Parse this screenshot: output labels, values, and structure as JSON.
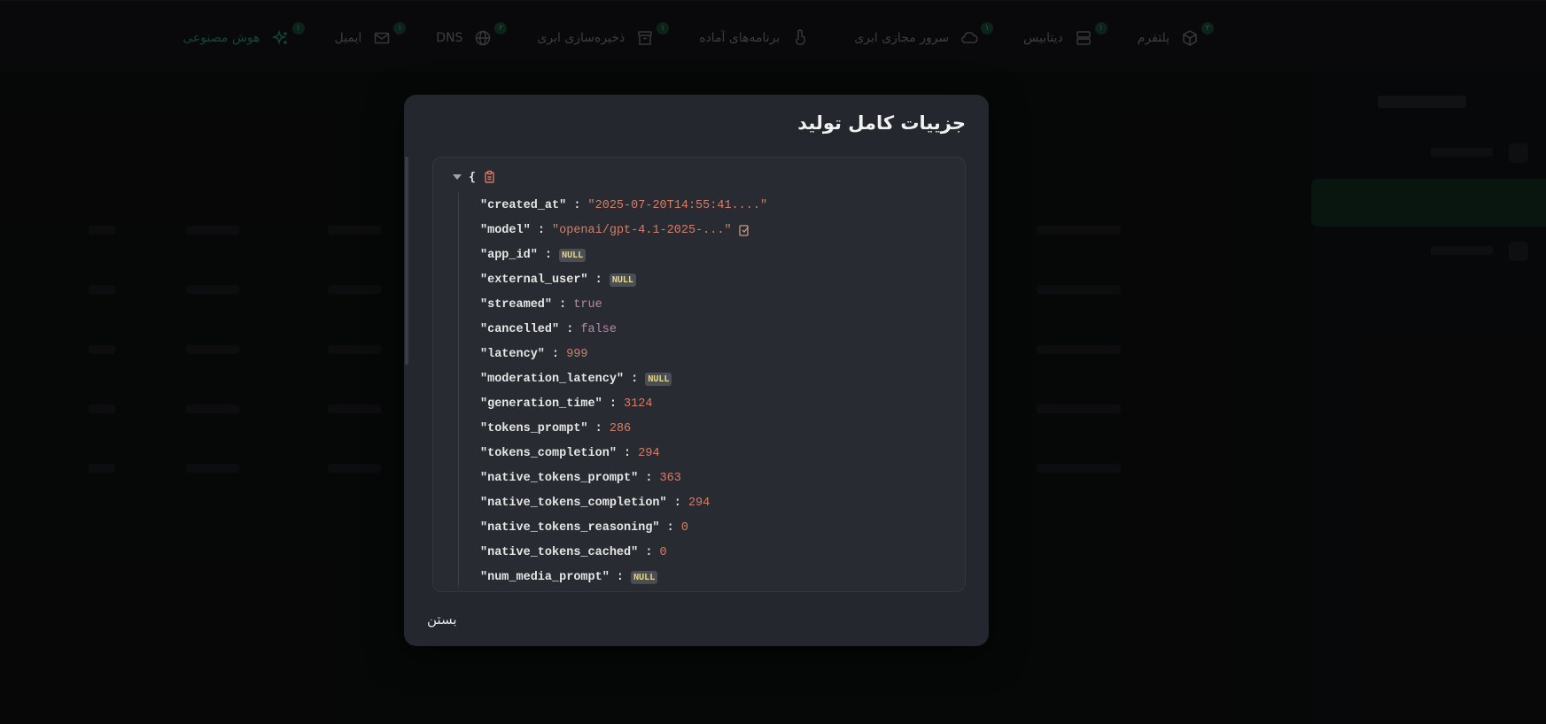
{
  "nav": {
    "items": [
      {
        "label": "پلتفرم",
        "badge": "۲",
        "icon": "cube-icon"
      },
      {
        "label": "دیتابیس",
        "badge": "۱",
        "icon": "database-icon"
      },
      {
        "label": "سرور مجازی ابری",
        "badge": "۱",
        "icon": "cloud-icon"
      },
      {
        "label": "برنامه‌های آماده",
        "badge": "",
        "icon": "app-icon"
      },
      {
        "label": "ذخیره‌سازی ابری",
        "badge": "۱",
        "icon": "archive-icon"
      },
      {
        "label": "DNS",
        "badge": "۲",
        "icon": "globe-icon"
      },
      {
        "label": "ایمیل",
        "badge": "۱",
        "icon": "mail-icon"
      },
      {
        "label": "هوش مصنوعی",
        "badge": "۱",
        "icon": "sparkle-icon",
        "active": true
      }
    ]
  },
  "modal": {
    "title": "جزییات کامل تولید",
    "close_label": "بستن",
    "json_open_brace": "{",
    "fields": [
      {
        "key": "\"created_at\"",
        "type": "string",
        "value": "\"2025-07-20T14:55:41....\""
      },
      {
        "key": "\"model\"",
        "type": "string",
        "value": "\"openai/gpt-4.1-2025-...\"",
        "copy": true
      },
      {
        "key": "\"app_id\"",
        "type": "null",
        "value": "NULL"
      },
      {
        "key": "\"external_user\"",
        "type": "null",
        "value": "NULL"
      },
      {
        "key": "\"streamed\"",
        "type": "bool",
        "value": "true"
      },
      {
        "key": "\"cancelled\"",
        "type": "bool",
        "value": "false"
      },
      {
        "key": "\"latency\"",
        "type": "number",
        "value": "999"
      },
      {
        "key": "\"moderation_latency\"",
        "type": "null",
        "value": "NULL"
      },
      {
        "key": "\"generation_time\"",
        "type": "number",
        "value": "3124"
      },
      {
        "key": "\"tokens_prompt\"",
        "type": "number",
        "value": "286"
      },
      {
        "key": "\"tokens_completion\"",
        "type": "number",
        "value": "294"
      },
      {
        "key": "\"native_tokens_prompt\"",
        "type": "number",
        "value": "363"
      },
      {
        "key": "\"native_tokens_completion\"",
        "type": "number",
        "value": "294"
      },
      {
        "key": "\"native_tokens_reasoning\"",
        "type": "number",
        "value": "0"
      },
      {
        "key": "\"native_tokens_cached\"",
        "type": "number",
        "value": "0"
      },
      {
        "key": "\"num_media_prompt\"",
        "type": "null",
        "value": "NULL"
      }
    ]
  },
  "colors": {
    "accent": "#1f6a52",
    "string": "#d57d66",
    "bool": "#b58aa8",
    "null_bg": "#4a4e56",
    "null_text": "#e7d58a"
  }
}
